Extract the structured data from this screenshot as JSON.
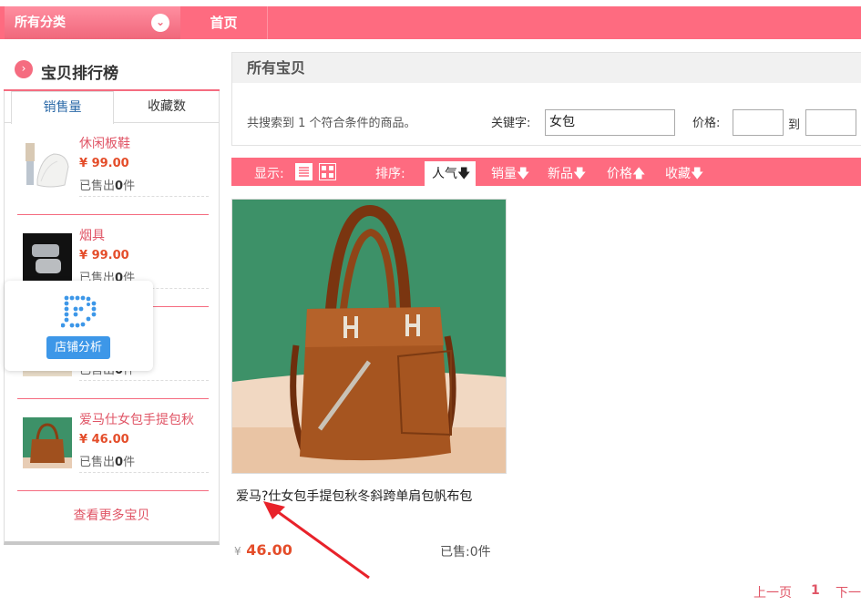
{
  "topnav": {
    "category_label": "所有分类",
    "home_label": "首页"
  },
  "sidebar": {
    "title": "宝贝排行榜",
    "tabs": [
      "销售量",
      "收藏数"
    ],
    "items": [
      {
        "name": "休闲板鞋",
        "price": "¥ 99.00",
        "sold_prefix": "已售出",
        "sold_count": "0",
        "sold_suffix": "件"
      },
      {
        "name": "烟具",
        "price": "¥ 99.00",
        "sold_prefix": "已售出",
        "sold_count": "0",
        "sold_suffix": "件"
      },
      {
        "name": "",
        "price": "",
        "sold_prefix": "已售出",
        "sold_count": "0",
        "sold_suffix": "件"
      },
      {
        "name": "爱马仕女包手提包秋",
        "price": "¥ 46.00",
        "sold_prefix": "已售出",
        "sold_count": "0",
        "sold_suffix": "件"
      }
    ],
    "more_label": "查看更多宝贝"
  },
  "widget": {
    "button_label": "店铺分析"
  },
  "main": {
    "title": "所有宝贝",
    "result_text": "共搜索到 1 个符合条件的商品。",
    "keyword_label": "关键字:",
    "keyword_value": "女包",
    "price_label": "价格:",
    "price_to": "到"
  },
  "sortbar": {
    "display_label": "显示:",
    "sort_label": "排序:",
    "options": [
      "人气",
      "销量",
      "新品",
      "价格",
      "收藏"
    ],
    "active": "人气"
  },
  "product": {
    "title": "爱马?仕女包手提包秋冬斜跨单肩包帆布包",
    "price_symbol": "¥",
    "price": "46.00",
    "sold": "已售:0件"
  },
  "pager": {
    "prev": "上一页",
    "current": "1",
    "next": "下一"
  },
  "colors": {
    "accent": "#fe6b80",
    "price": "#e44d2a",
    "link": "#e05566"
  }
}
